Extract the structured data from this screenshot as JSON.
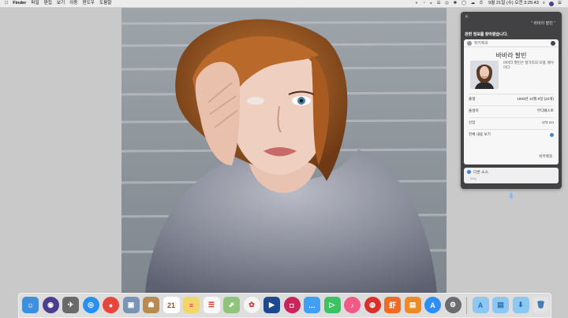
{
  "menubar": {
    "app_name": "Finder",
    "menus": [
      "파일",
      "편집",
      "보기",
      "이동",
      "윈도우",
      "도움말"
    ],
    "clock": "9월 21일 (수) 오전 3:25:43"
  },
  "siri": {
    "query": "\" 바바라 팔빈 \"",
    "prompt": "관련 정보를 찾아봤습니다.",
    "card": {
      "source_header": "위키백과",
      "name": "바바라 팔빈",
      "description": "바바라 팔빈은 헝가리의 모델, 배우이다.",
      "rows": [
        {
          "label": "출생",
          "value": "1993년 10월 8일 (22세)"
        },
        {
          "label": "출생지",
          "value": "부다페스트"
        },
        {
          "label": "신장",
          "value": "172 cm"
        }
      ],
      "toggle_label": "전체 내용 보기",
      "source_footer": "위키백과"
    },
    "other_sources": {
      "label": "다른 소스",
      "engine": "bing"
    }
  },
  "dock": {
    "apps": [
      {
        "name": "finder-icon",
        "color": "#3d8fe0",
        "glyph": "☺"
      },
      {
        "name": "siri-icon",
        "color": "#4b3e8f",
        "glyph": "◉"
      },
      {
        "name": "launchpad-icon",
        "color": "#6a6a6a",
        "glyph": "✈"
      },
      {
        "name": "safari-icon",
        "color": "#2a8ff0",
        "glyph": "◎"
      },
      {
        "name": "chrome-icon",
        "color": "#e8463a",
        "glyph": "●"
      },
      {
        "name": "preview-icon",
        "color": "#7a94b3",
        "glyph": "▣"
      },
      {
        "name": "contacts-icon",
        "color": "#b98a52",
        "glyph": "☗"
      },
      {
        "name": "calendar-icon",
        "color": "#ffffff",
        "glyph": "21"
      },
      {
        "name": "notes-icon",
        "color": "#f4d56b",
        "glyph": "≡"
      },
      {
        "name": "reminders-icon",
        "color": "#f8f8f8",
        "glyph": "☰"
      },
      {
        "name": "maps-icon",
        "color": "#8fc47a",
        "glyph": "⬈"
      },
      {
        "name": "photos-icon",
        "color": "#f5f5f5",
        "glyph": "✿"
      },
      {
        "name": "keynote-icon",
        "color": "#1d4a8c",
        "glyph": "▶"
      },
      {
        "name": "photo-booth-icon",
        "color": "#c7265a",
        "glyph": "◘"
      },
      {
        "name": "messages-icon",
        "color": "#3fa1f5",
        "glyph": "…"
      },
      {
        "name": "facetime-icon",
        "color": "#3cc163",
        "glyph": "▷"
      },
      {
        "name": "itunes-icon",
        "color": "#f05b86",
        "glyph": "♪"
      },
      {
        "name": "netease-music-icon",
        "color": "#d8302a",
        "glyph": "◍"
      },
      {
        "name": "xiami-music-icon",
        "color": "#f06a23",
        "glyph": "虾"
      },
      {
        "name": "ibooks-icon",
        "color": "#f08a24",
        "glyph": "▤"
      },
      {
        "name": "app-store-icon",
        "color": "#2f8ef5",
        "glyph": "A"
      },
      {
        "name": "system-preferences-icon",
        "color": "#6c6c70",
        "glyph": "⚙"
      }
    ],
    "folders": [
      {
        "name": "applications-folder-icon",
        "color": "#8ec7f0",
        "glyph": "A"
      },
      {
        "name": "documents-folder-icon",
        "color": "#8ec7f0",
        "glyph": "▤"
      },
      {
        "name": "downloads-folder-icon",
        "color": "#8ec7f0",
        "glyph": "⬇"
      },
      {
        "name": "trash-icon",
        "color": "#e4e4e4",
        "glyph": "🗑"
      }
    ]
  }
}
